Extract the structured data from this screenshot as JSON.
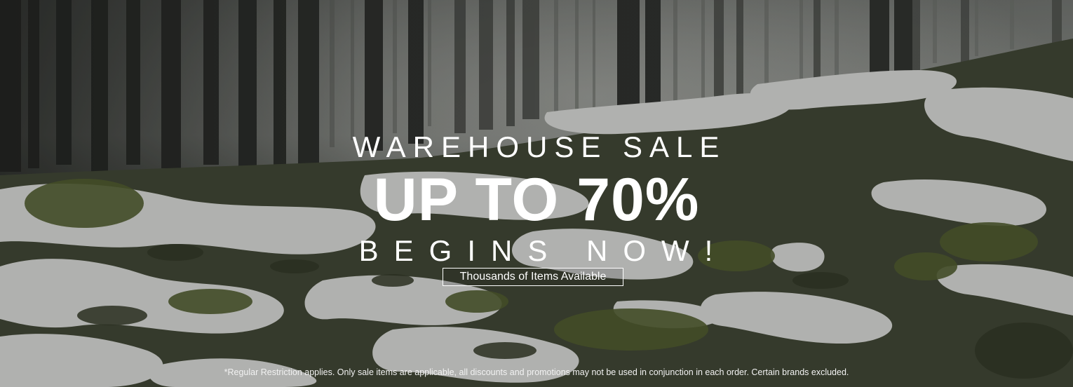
{
  "banner": {
    "line1": "WAREHOUSE SALE",
    "line2": "UP TO 70%",
    "line3": "BEGINS NOW!",
    "cta_label": "Thousands of Items Available",
    "disclaimer": "*Regular Restriction applies. Only sale items are applicable, all discounts and promotions may not be used in conjunction in each order. Certain brands excluded."
  },
  "background": {
    "scene": "forest-snow-photo",
    "colors": {
      "fog": "#9a9d98",
      "snow": "#d8d8d8",
      "moss": "#3d4a25",
      "trunk": "#3a3b38"
    }
  }
}
